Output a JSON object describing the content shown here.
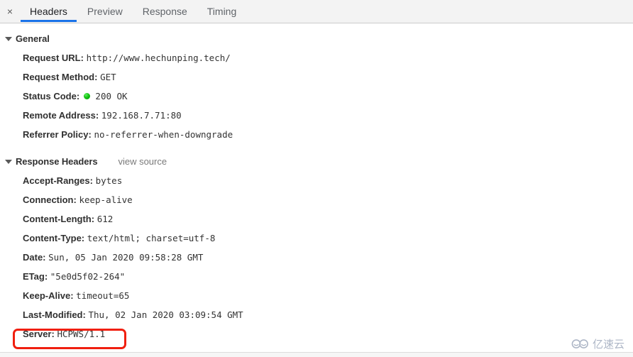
{
  "tabbar": {
    "close_icon": "close-icon",
    "close_label": "×",
    "tabs": [
      {
        "label": "Headers",
        "active": true
      },
      {
        "label": "Preview",
        "active": false
      },
      {
        "label": "Response",
        "active": false
      },
      {
        "label": "Timing",
        "active": false
      }
    ]
  },
  "general": {
    "title": "General",
    "rows": [
      {
        "key": "Request URL:",
        "value": "http://www.hechunping.tech/"
      },
      {
        "key": "Request Method:",
        "value": "GET"
      },
      {
        "key": "Status Code:",
        "value": "200 OK",
        "status_dot": true,
        "status_color": "#14c314"
      },
      {
        "key": "Remote Address:",
        "value": "192.168.7.71:80"
      },
      {
        "key": "Referrer Policy:",
        "value": "no-referrer-when-downgrade"
      }
    ]
  },
  "response_headers": {
    "title": "Response Headers",
    "view_source_label": "view source",
    "rows": [
      {
        "key": "Accept-Ranges:",
        "value": "bytes"
      },
      {
        "key": "Connection:",
        "value": "keep-alive"
      },
      {
        "key": "Content-Length:",
        "value": "612"
      },
      {
        "key": "Content-Type:",
        "value": "text/html; charset=utf-8"
      },
      {
        "key": "Date:",
        "value": "Sun, 05 Jan 2020 09:58:28 GMT"
      },
      {
        "key": "ETag:",
        "value": "\"5e0d5f02-264\""
      },
      {
        "key": "Keep-Alive:",
        "value": "timeout=65"
      },
      {
        "key": "Last-Modified:",
        "value": "Thu, 02 Jan 2020 03:09:54 GMT"
      },
      {
        "key": "Server:",
        "value": "HCPWS/1.1",
        "highlighted": true
      }
    ]
  },
  "annotation": {
    "color": "#f01f0f",
    "target": "Server: HCPWS/1.1"
  },
  "watermark": {
    "text": "亿速云",
    "color": "#a9b3c4"
  }
}
